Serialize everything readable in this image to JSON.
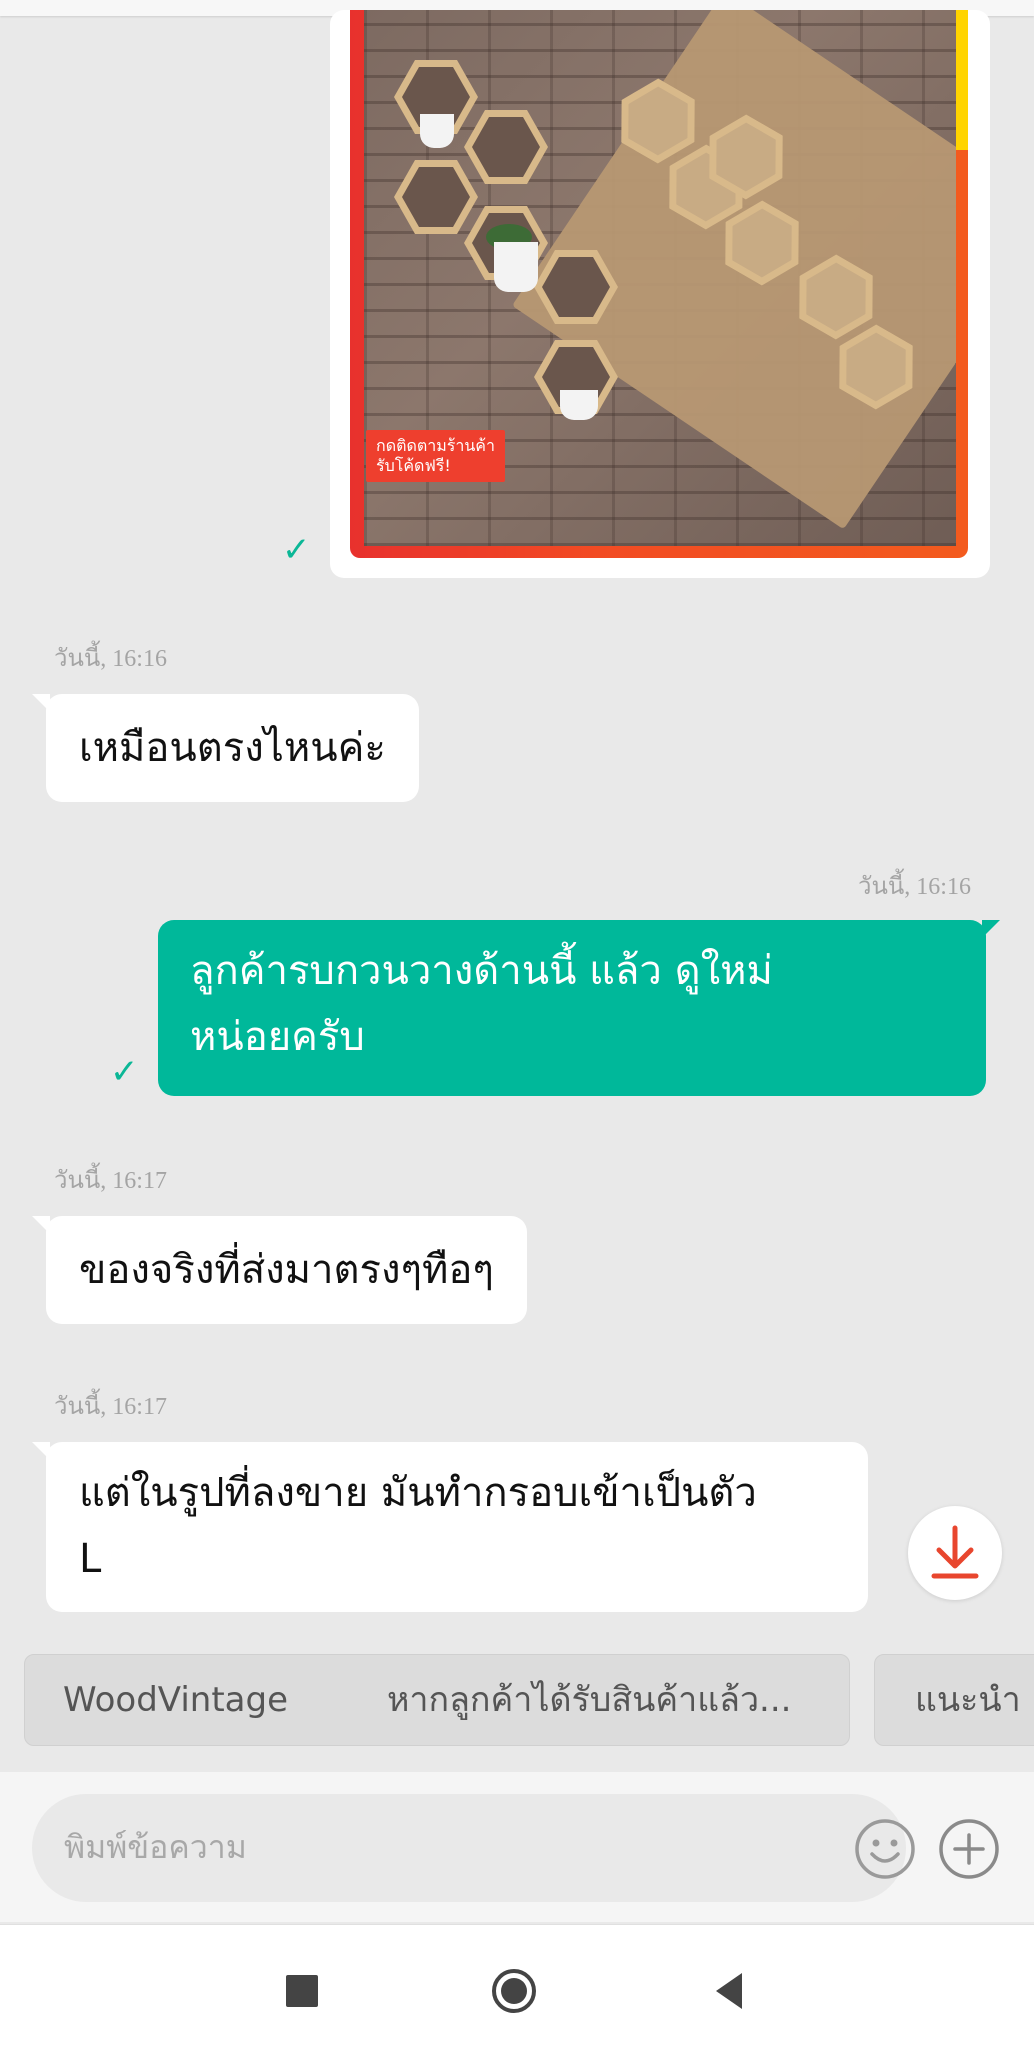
{
  "messages": [
    {
      "type": "image",
      "direction": "out",
      "promo_line1": "กดติดตามร้านค้า",
      "promo_line2": "รับโค้ดฟรี!",
      "status": "sent"
    },
    {
      "type": "text",
      "direction": "in",
      "time": "วันนี้, 16:16",
      "text": "เหมือนตรงไหนค่ะ"
    },
    {
      "type": "text",
      "direction": "out",
      "time": "วันนี้, 16:16",
      "line1": "ลูกค้ารบกวนวางด้านนี้ แล้ว ดูใหม่",
      "line2": "หน่อยครับ",
      "status": "sent"
    },
    {
      "type": "text",
      "direction": "in",
      "time": "วันนี้, 16:17",
      "text": "ของจริงที่ส่งมาตรงๆทือๆ"
    },
    {
      "type": "text",
      "direction": "in",
      "time": "วันนี้, 16:17",
      "line1": "แต่ในรูปที่ลงขาย มันทำกรอบเข้าเป็นตัว",
      "line2": "L"
    }
  ],
  "quick_replies": [
    {
      "title": "WoodVintage",
      "preview": "หากลูกค้าได้รับสินค้าแล้ว..."
    },
    {
      "title": "แนะนำ"
    }
  ],
  "composer": {
    "placeholder": "พิมพ์ข้อความ"
  },
  "icons": {
    "download": "download-icon",
    "emoji": "emoji-icon",
    "add": "plus-icon",
    "check": "check-icon"
  },
  "colors": {
    "accent": "#00b89a",
    "download": "#e8462e",
    "background": "#e9e9e9"
  }
}
